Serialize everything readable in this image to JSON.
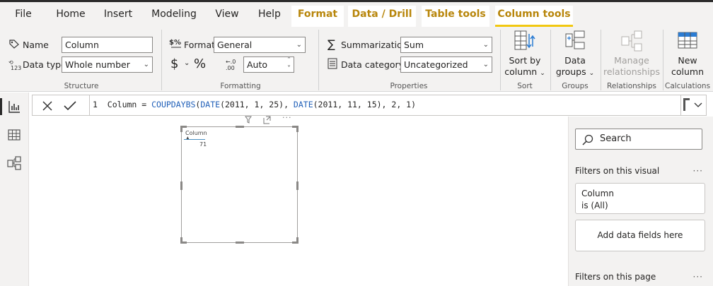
{
  "tabs": [
    {
      "label": "File"
    },
    {
      "label": "Home"
    },
    {
      "label": "Insert"
    },
    {
      "label": "Modeling"
    },
    {
      "label": "View"
    },
    {
      "label": "Help"
    },
    {
      "label": "Format"
    },
    {
      "label": "Data / Drill"
    },
    {
      "label": "Table tools"
    },
    {
      "label": "Column tools"
    }
  ],
  "ribbon": {
    "structure": {
      "name_label": "Name",
      "name_value": "Column",
      "datatype_label": "Data type",
      "datatype_value": "Whole number",
      "group_label": "Structure"
    },
    "formatting": {
      "format_label": "Format",
      "format_value": "General",
      "currency_symbol": "$",
      "percent_symbol": "%",
      "decimals_value": "Auto",
      "group_label": "Formatting"
    },
    "properties": {
      "summarization_label": "Summarization",
      "summarization_value": "Sum",
      "category_label": "Data category",
      "category_value": "Uncategorized",
      "group_label": "Properties"
    },
    "sort": {
      "line1": "Sort by",
      "line2": "column",
      "group_label": "Sort"
    },
    "groups": {
      "line1": "Data",
      "line2": "groups",
      "group_label": "Groups"
    },
    "relationships": {
      "line1": "Manage",
      "line2": "relationships",
      "group_label": "Relationships"
    },
    "calculations": {
      "line1": "New",
      "line2": "column",
      "group_label": "Calculations"
    }
  },
  "formula_bar": {
    "line_number": "1",
    "prefix": "Column = ",
    "fn1": "COUPDAYBS",
    "p1": "(",
    "fn2": "DATE",
    "args1": "(2011, 1, 25), ",
    "fn3": "DATE",
    "args2": "(2011, 11, 15), 2, 1)"
  },
  "visual": {
    "header": "Column",
    "value": "71",
    "more": "···"
  },
  "filters": {
    "search_placeholder": "Search",
    "on_visual_heading": "Filters on this visual",
    "card_field": "Column",
    "card_state": "is (All)",
    "add_fields": "Add data fields here",
    "on_page_heading": "Filters on this page",
    "more": "···"
  },
  "colors": {
    "contextual_tab": "#b8860b",
    "active_underline": "#f2c811",
    "function_text": "#1f5fb8"
  }
}
